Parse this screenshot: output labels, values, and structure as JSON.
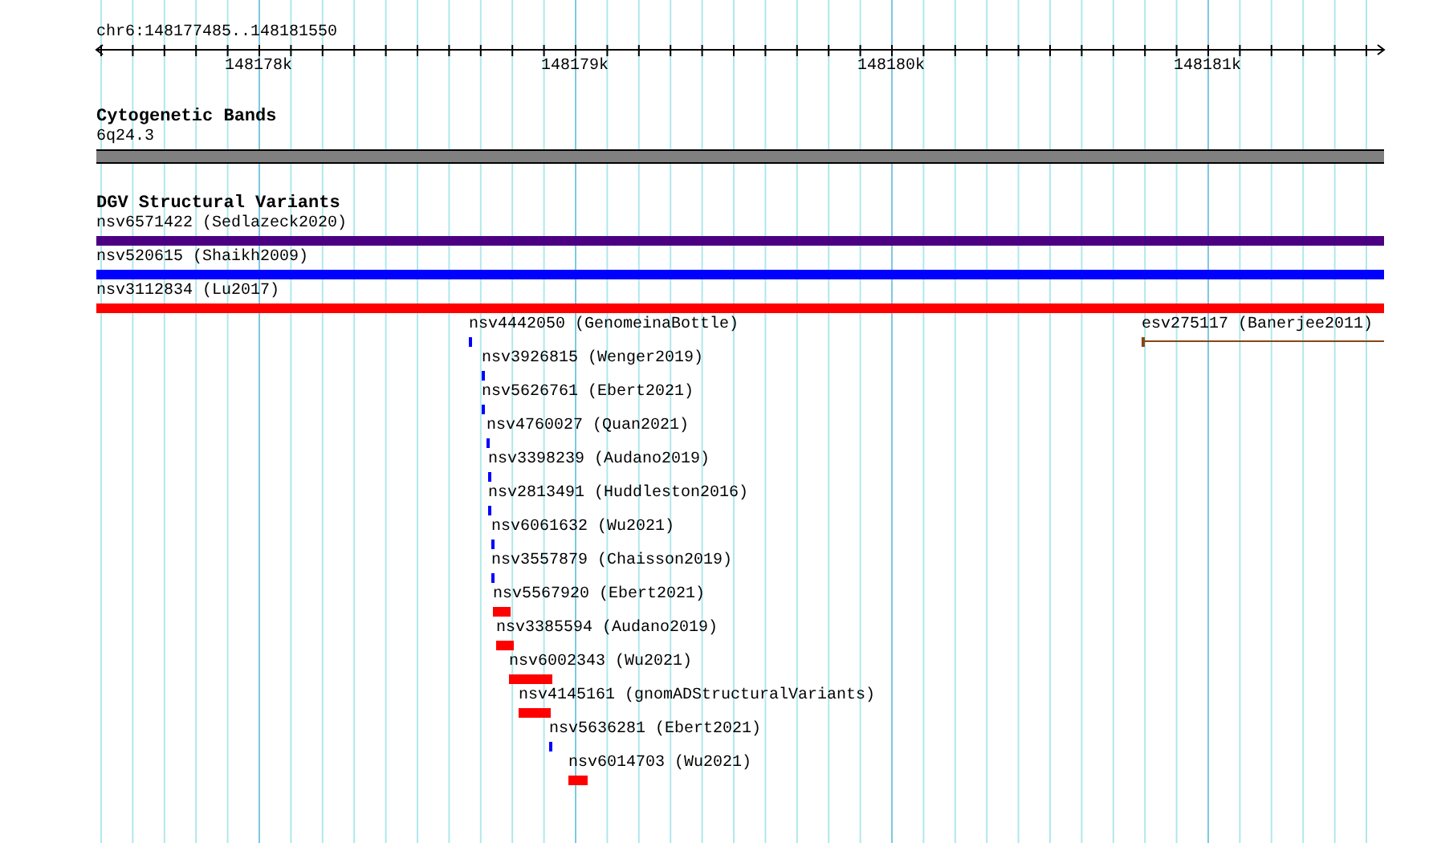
{
  "ruler": {
    "location": "chr6:148177485..148181550",
    "ticks": [
      "148178k",
      "148179k",
      "148180k",
      "148181k"
    ]
  },
  "tracks": [
    {
      "title": "Cytogenetic Bands",
      "features": [
        {
          "label": "6q24.3",
          "kind": "band",
          "color": "#808080"
        }
      ]
    },
    {
      "title": "DGV Structural Variants",
      "features": [
        {
          "label": "nsv6571422 (Sedlazeck2020)",
          "kind": "bar",
          "color": "#4b0082"
        },
        {
          "label": "nsv520615 (Shaikh2009)",
          "kind": "bar",
          "color": "#0000ff"
        },
        {
          "label": "nsv3112834 (Lu2017)",
          "kind": "bar",
          "color": "#ff0000"
        },
        {
          "label": "nsv4442050 (GenomeinaBottle)",
          "kind": "bar",
          "color": "#0000ff"
        },
        {
          "label": "esv275117 (Banerjee2011)",
          "kind": "line",
          "color": "#8b4513"
        },
        {
          "label": "nsv3926815 (Wenger2019)",
          "kind": "bar",
          "color": "#0000ff"
        },
        {
          "label": "nsv5626761 (Ebert2021)",
          "kind": "bar",
          "color": "#0000ff"
        },
        {
          "label": "nsv4760027 (Quan2021)",
          "kind": "bar",
          "color": "#0000ff"
        },
        {
          "label": "nsv3398239 (Audano2019)",
          "kind": "bar",
          "color": "#0000ff"
        },
        {
          "label": "nsv2813491 (Huddleston2016)",
          "kind": "bar",
          "color": "#0000ff"
        },
        {
          "label": "nsv6061632 (Wu2021)",
          "kind": "bar",
          "color": "#0000ff"
        },
        {
          "label": "nsv3557879 (Chaisson2019)",
          "kind": "bar",
          "color": "#0000ff"
        },
        {
          "label": "nsv5567920 (Ebert2021)",
          "kind": "bar",
          "color": "#ff0000"
        },
        {
          "label": "nsv3385594 (Audano2019)",
          "kind": "bar",
          "color": "#ff0000"
        },
        {
          "label": "nsv6002343 (Wu2021)",
          "kind": "bar",
          "color": "#ff0000"
        },
        {
          "label": "nsv4145161 (gnomADStructuralVariants)",
          "kind": "bar",
          "color": "#ff0000"
        },
        {
          "label": "nsv5636281 (Ebert2021)",
          "kind": "bar",
          "color": "#0000ff"
        },
        {
          "label": "nsv6014703 (Wu2021)",
          "kind": "bar",
          "color": "#ff0000"
        }
      ]
    }
  ]
}
